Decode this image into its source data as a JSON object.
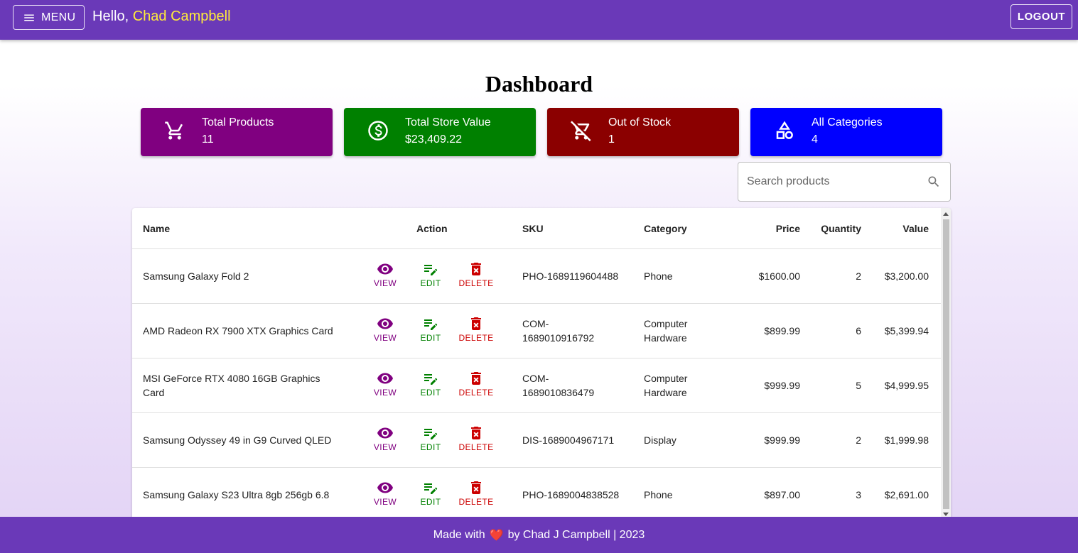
{
  "header": {
    "menu_label": "MENU",
    "greeting_prefix": "Hello, ",
    "user_name": "Chad Campbell",
    "logout_label": "LOGOUT"
  },
  "page": {
    "title": "Dashboard"
  },
  "cards": [
    {
      "label": "Total Products",
      "value": "11",
      "color": "#800080",
      "icon": "cart-icon"
    },
    {
      "label": "Total Store Value",
      "value": "$23,409.22",
      "color": "#008000",
      "icon": "dollar-circle-icon"
    },
    {
      "label": "Out of Stock",
      "value": "1",
      "color": "#8b0000",
      "icon": "cart-off-icon"
    },
    {
      "label": "All Categories",
      "value": "4",
      "color": "#0000ff",
      "icon": "categories-icon"
    }
  ],
  "search": {
    "placeholder": "Search products",
    "value": ""
  },
  "table": {
    "headers": {
      "name": "Name",
      "action": "Action",
      "sku": "SKU",
      "category": "Category",
      "price": "Price",
      "quantity": "Quantity",
      "value": "Value"
    },
    "action_labels": {
      "view": "VIEW",
      "edit": "EDIT",
      "delete": "DELETE"
    },
    "rows": [
      {
        "name": [
          "Samsung Galaxy Fold 2"
        ],
        "sku": [
          "PHO-1689119604488"
        ],
        "category": [
          "Phone"
        ],
        "price": "$1600.00",
        "quantity": "2",
        "value": "$3,200.00"
      },
      {
        "name": [
          "AMD Radeon RX 7900 XTX Graphics Card"
        ],
        "sku": [
          "COM-",
          "1689010916792"
        ],
        "category": [
          "Computer",
          "Hardware"
        ],
        "price": "$899.99",
        "quantity": "6",
        "value": "$5,399.94"
      },
      {
        "name": [
          "MSI GeForce RTX 4080 16GB Graphics",
          "Card"
        ],
        "sku": [
          "COM-",
          "1689010836479"
        ],
        "category": [
          "Computer",
          "Hardware"
        ],
        "price": "$999.99",
        "quantity": "5",
        "value": "$4,999.95"
      },
      {
        "name": [
          "Samsung Odyssey 49 in G9 Curved QLED"
        ],
        "sku": [
          "DIS-1689004967171"
        ],
        "category": [
          "Display"
        ],
        "price": "$999.99",
        "quantity": "2",
        "value": "$1,999.98"
      },
      {
        "name": [
          "Samsung Galaxy S23 Ultra 8gb 256gb 6.8"
        ],
        "sku": [
          "PHO-1689004838528"
        ],
        "category": [
          "Phone"
        ],
        "price": "$897.00",
        "quantity": "3",
        "value": "$2,691.00"
      }
    ]
  },
  "footer": {
    "prefix": "Made with",
    "heart": "❤️",
    "suffix": "by Chad J Campbell | 2023"
  }
}
